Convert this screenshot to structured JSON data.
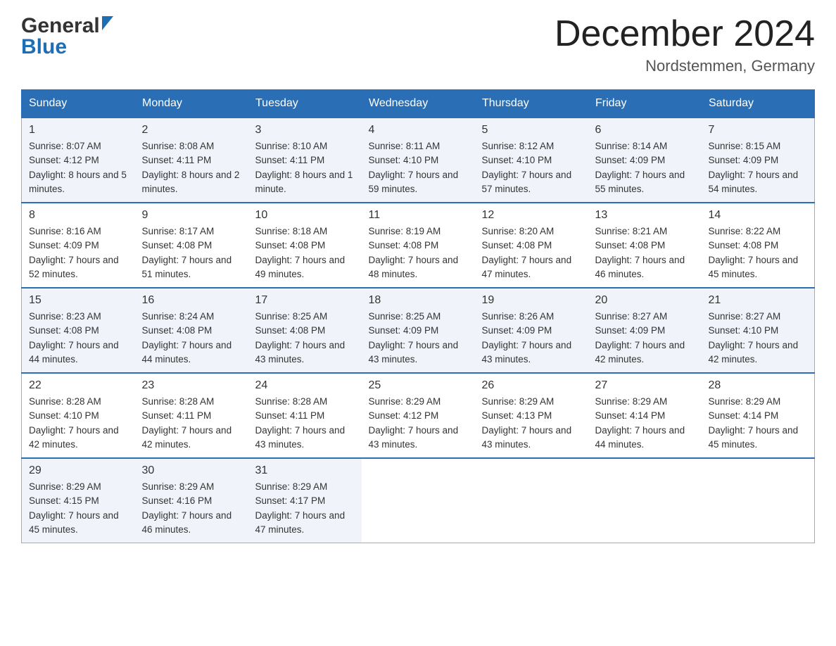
{
  "header": {
    "logo_general": "General",
    "logo_blue": "Blue",
    "month_title": "December 2024",
    "location": "Nordstemmen, Germany"
  },
  "days_of_week": [
    "Sunday",
    "Monday",
    "Tuesday",
    "Wednesday",
    "Thursday",
    "Friday",
    "Saturday"
  ],
  "weeks": [
    {
      "days": [
        {
          "num": "1",
          "sunrise": "8:07 AM",
          "sunset": "4:12 PM",
          "daylight": "8 hours and 5 minutes."
        },
        {
          "num": "2",
          "sunrise": "8:08 AM",
          "sunset": "4:11 PM",
          "daylight": "8 hours and 2 minutes."
        },
        {
          "num": "3",
          "sunrise": "8:10 AM",
          "sunset": "4:11 PM",
          "daylight": "8 hours and 1 minute."
        },
        {
          "num": "4",
          "sunrise": "8:11 AM",
          "sunset": "4:10 PM",
          "daylight": "7 hours and 59 minutes."
        },
        {
          "num": "5",
          "sunrise": "8:12 AM",
          "sunset": "4:10 PM",
          "daylight": "7 hours and 57 minutes."
        },
        {
          "num": "6",
          "sunrise": "8:14 AM",
          "sunset": "4:09 PM",
          "daylight": "7 hours and 55 minutes."
        },
        {
          "num": "7",
          "sunrise": "8:15 AM",
          "sunset": "4:09 PM",
          "daylight": "7 hours and 54 minutes."
        }
      ]
    },
    {
      "days": [
        {
          "num": "8",
          "sunrise": "8:16 AM",
          "sunset": "4:09 PM",
          "daylight": "7 hours and 52 minutes."
        },
        {
          "num": "9",
          "sunrise": "8:17 AM",
          "sunset": "4:08 PM",
          "daylight": "7 hours and 51 minutes."
        },
        {
          "num": "10",
          "sunrise": "8:18 AM",
          "sunset": "4:08 PM",
          "daylight": "7 hours and 49 minutes."
        },
        {
          "num": "11",
          "sunrise": "8:19 AM",
          "sunset": "4:08 PM",
          "daylight": "7 hours and 48 minutes."
        },
        {
          "num": "12",
          "sunrise": "8:20 AM",
          "sunset": "4:08 PM",
          "daylight": "7 hours and 47 minutes."
        },
        {
          "num": "13",
          "sunrise": "8:21 AM",
          "sunset": "4:08 PM",
          "daylight": "7 hours and 46 minutes."
        },
        {
          "num": "14",
          "sunrise": "8:22 AM",
          "sunset": "4:08 PM",
          "daylight": "7 hours and 45 minutes."
        }
      ]
    },
    {
      "days": [
        {
          "num": "15",
          "sunrise": "8:23 AM",
          "sunset": "4:08 PM",
          "daylight": "7 hours and 44 minutes."
        },
        {
          "num": "16",
          "sunrise": "8:24 AM",
          "sunset": "4:08 PM",
          "daylight": "7 hours and 44 minutes."
        },
        {
          "num": "17",
          "sunrise": "8:25 AM",
          "sunset": "4:08 PM",
          "daylight": "7 hours and 43 minutes."
        },
        {
          "num": "18",
          "sunrise": "8:25 AM",
          "sunset": "4:09 PM",
          "daylight": "7 hours and 43 minutes."
        },
        {
          "num": "19",
          "sunrise": "8:26 AM",
          "sunset": "4:09 PM",
          "daylight": "7 hours and 43 minutes."
        },
        {
          "num": "20",
          "sunrise": "8:27 AM",
          "sunset": "4:09 PM",
          "daylight": "7 hours and 42 minutes."
        },
        {
          "num": "21",
          "sunrise": "8:27 AM",
          "sunset": "4:10 PM",
          "daylight": "7 hours and 42 minutes."
        }
      ]
    },
    {
      "days": [
        {
          "num": "22",
          "sunrise": "8:28 AM",
          "sunset": "4:10 PM",
          "daylight": "7 hours and 42 minutes."
        },
        {
          "num": "23",
          "sunrise": "8:28 AM",
          "sunset": "4:11 PM",
          "daylight": "7 hours and 42 minutes."
        },
        {
          "num": "24",
          "sunrise": "8:28 AM",
          "sunset": "4:11 PM",
          "daylight": "7 hours and 43 minutes."
        },
        {
          "num": "25",
          "sunrise": "8:29 AM",
          "sunset": "4:12 PM",
          "daylight": "7 hours and 43 minutes."
        },
        {
          "num": "26",
          "sunrise": "8:29 AM",
          "sunset": "4:13 PM",
          "daylight": "7 hours and 43 minutes."
        },
        {
          "num": "27",
          "sunrise": "8:29 AM",
          "sunset": "4:14 PM",
          "daylight": "7 hours and 44 minutes."
        },
        {
          "num": "28",
          "sunrise": "8:29 AM",
          "sunset": "4:14 PM",
          "daylight": "7 hours and 45 minutes."
        }
      ]
    },
    {
      "days": [
        {
          "num": "29",
          "sunrise": "8:29 AM",
          "sunset": "4:15 PM",
          "daylight": "7 hours and 45 minutes."
        },
        {
          "num": "30",
          "sunrise": "8:29 AM",
          "sunset": "4:16 PM",
          "daylight": "7 hours and 46 minutes."
        },
        {
          "num": "31",
          "sunrise": "8:29 AM",
          "sunset": "4:17 PM",
          "daylight": "7 hours and 47 minutes."
        },
        null,
        null,
        null,
        null
      ]
    }
  ]
}
